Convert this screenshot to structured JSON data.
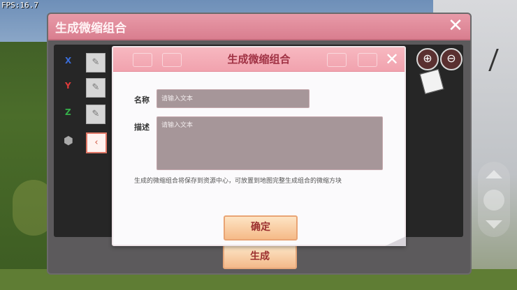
{
  "hud": {
    "fps": "FPS:16.7"
  },
  "back_panel": {
    "title": "生成微缩组合",
    "close_icon": "close-icon",
    "axes": [
      {
        "label": "X",
        "color": "#3a6dd8",
        "button_icon": "pencil-icon"
      },
      {
        "label": "Y",
        "color": "#e03a3a",
        "button_icon": "pencil-icon"
      },
      {
        "label": "Z",
        "color": "#35b04a",
        "button_icon": "pencil-icon"
      },
      {
        "label": "",
        "color": "#aaaaaa",
        "button_icon": "arrow-left-icon"
      }
    ],
    "zoom_in": "⊕",
    "zoom_out": "⊖",
    "generate_label": "生成"
  },
  "dialog": {
    "title": "生成微缩组合",
    "name_label": "名称",
    "name_placeholder": "请输入文本",
    "desc_label": "描述",
    "desc_placeholder": "请输入文本",
    "hint": "生成的微缩组合将保存到资源中心，可放置到地图完整生成组合的微缩方块",
    "confirm_label": "确定"
  },
  "colors": {
    "accent_pink": "#f1a2ae",
    "title_red": "#a03244",
    "input_bg": "#a69699"
  }
}
